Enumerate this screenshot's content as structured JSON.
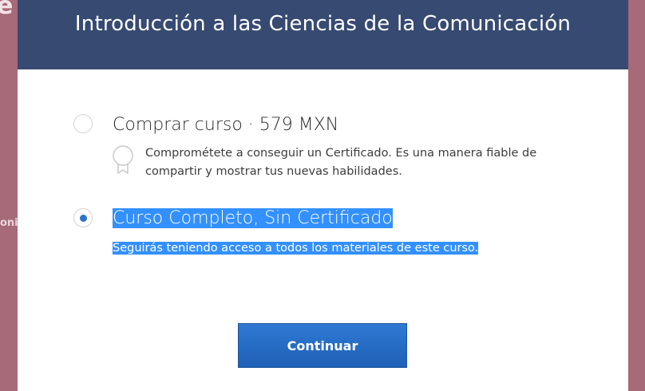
{
  "background": {
    "fragment_top": "e",
    "fragment_mid": "oni"
  },
  "modal": {
    "title": "Introducción a las Ciencias de la Comunicación",
    "header_color": "#374a71"
  },
  "options": [
    {
      "label": "Comprar curso · 579 MXN",
      "description": "Comprométete a conseguir un Certificado. Es una manera fiable de compartir y mostrar tus nuevas habilidades.",
      "icon": "certificate-icon",
      "selected": false
    },
    {
      "label": "Curso Completo, Sin Certificado",
      "description": "Seguirás teniendo acceso a todos los materiales de este curso.",
      "selected": true
    }
  ],
  "continue_button": {
    "label": "Continuar",
    "color": "#2a6cc4"
  },
  "selection_highlight_color": "#3390ff"
}
